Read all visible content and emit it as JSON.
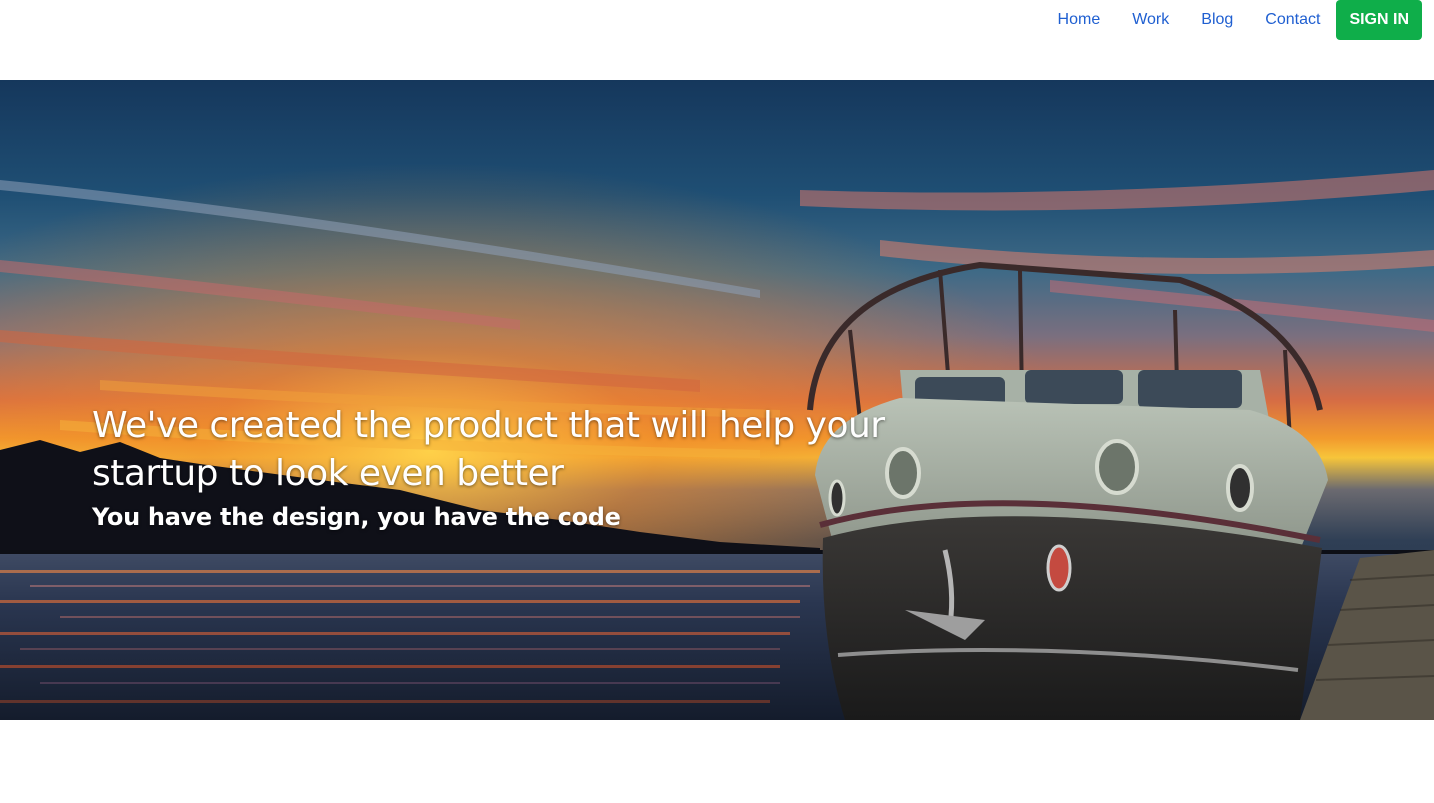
{
  "nav": {
    "links": [
      {
        "label": "Home"
      },
      {
        "label": "Work"
      },
      {
        "label": "Blog"
      },
      {
        "label": "Contact"
      }
    ],
    "signin_label": "SIGN IN"
  },
  "hero": {
    "title": "We've created the product that will help your startup to look even better",
    "subtitle": "You have the design, you have the code",
    "image": "boat-at-sunset-photo"
  },
  "colors": {
    "link": "#1f5fd1",
    "signin_bg": "#0fae4a",
    "signin_text": "#ffffff",
    "hero_text": "#ffffff"
  }
}
